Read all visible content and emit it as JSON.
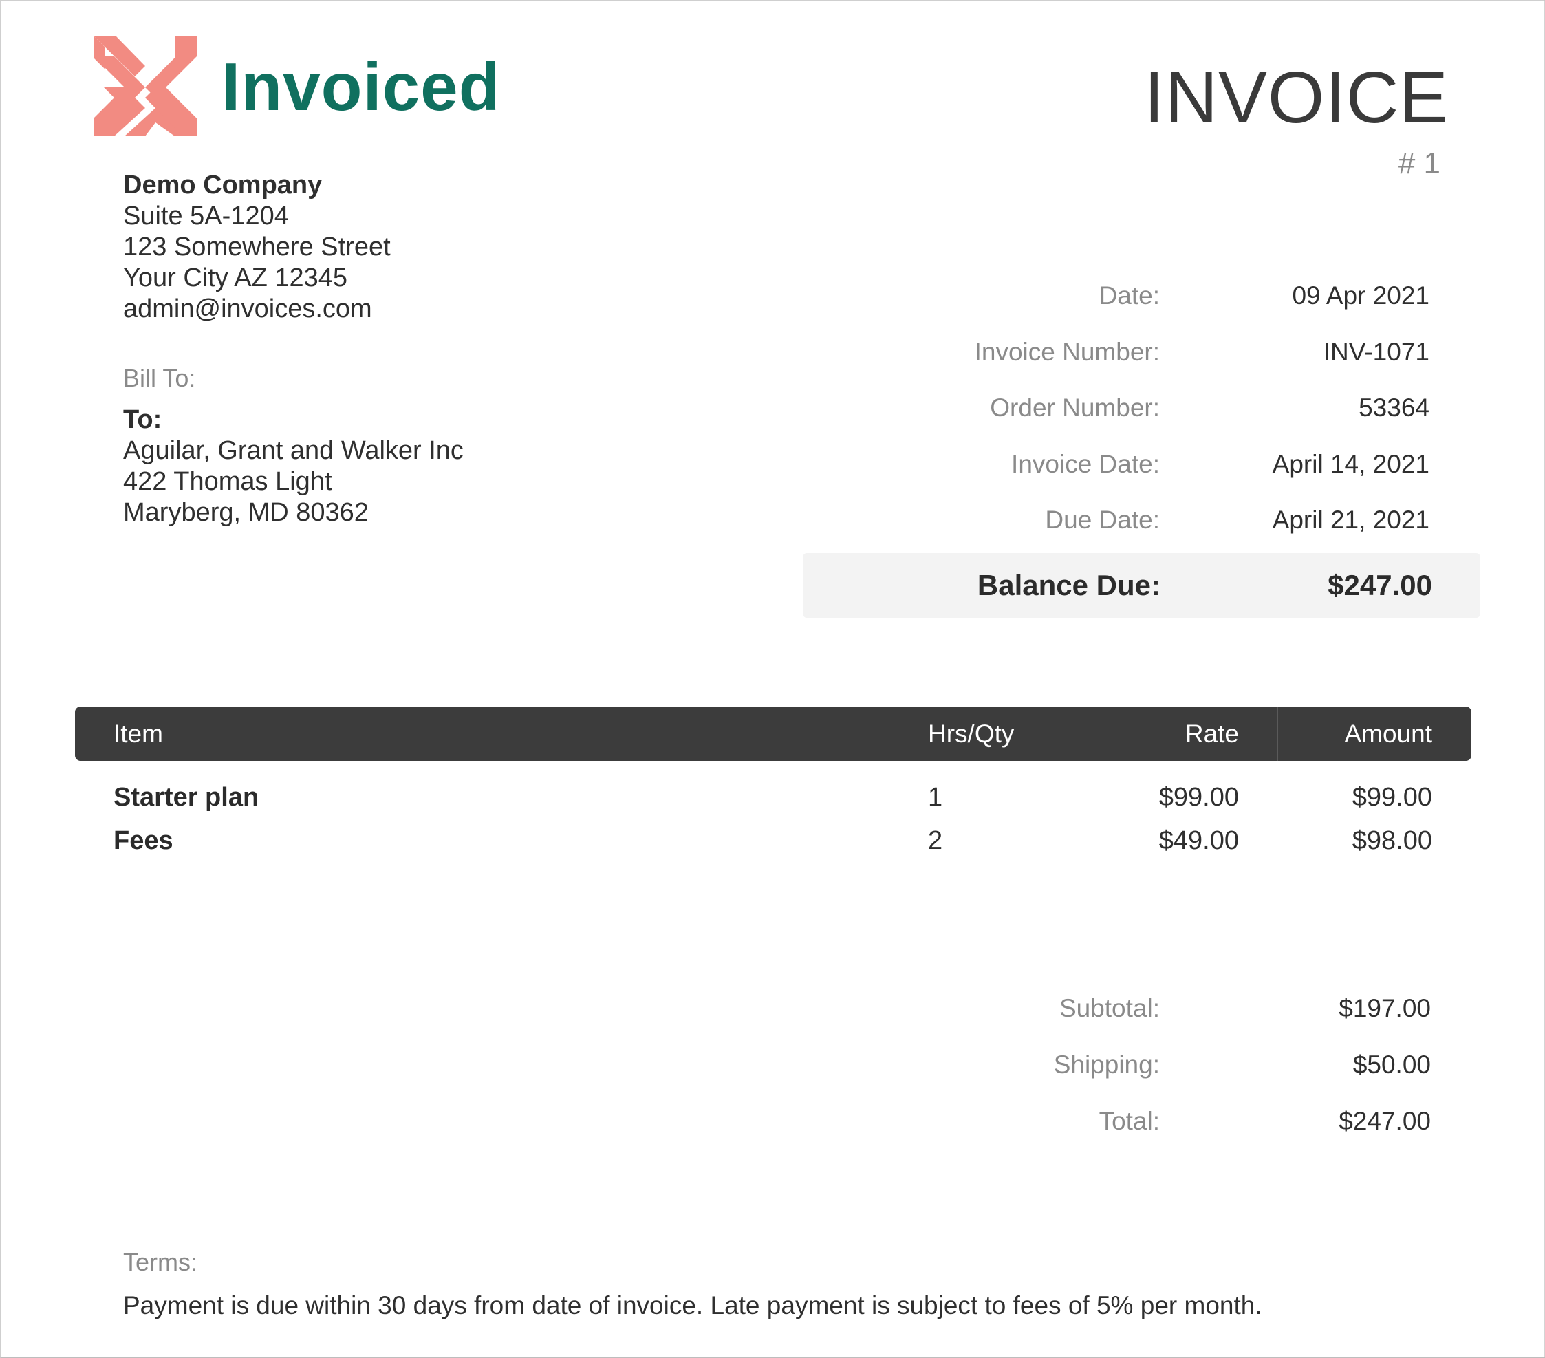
{
  "brand": {
    "name": "Invoiced",
    "logo_icon": "invoiced-chevron-x-logo",
    "logo_color": "#f28b82",
    "name_color": "#10705f"
  },
  "header": {
    "title": "INVOICE",
    "number": "# 1"
  },
  "from": {
    "company": "Demo Company",
    "address_lines": [
      "Suite 5A-1204",
      "123 Somewhere Street",
      "Your City AZ 12345"
    ],
    "email": "admin@invoices.com"
  },
  "bill_to": {
    "label": "Bill To:",
    "heading": "To:",
    "lines": [
      "Aguilar, Grant and Walker Inc",
      "422 Thomas Light",
      "Maryberg, MD 80362"
    ]
  },
  "meta": [
    {
      "label": "Date:",
      "value": "09 Apr 2021"
    },
    {
      "label": "Invoice Number:",
      "value": "INV-1071"
    },
    {
      "label": "Order Number:",
      "value": "53364"
    },
    {
      "label": "Invoice Date:",
      "value": "April 14, 2021"
    },
    {
      "label": "Due Date:",
      "value": "April 21, 2021"
    }
  ],
  "balance": {
    "label": "Balance Due:",
    "value": "$247.00"
  },
  "items_table": {
    "columns": [
      "Item",
      "Hrs/Qty",
      "Rate",
      "Amount"
    ],
    "header_bg": "#3c3c3c",
    "rows": [
      {
        "item": "Starter plan",
        "qty": "1",
        "rate": "$99.00",
        "amount": "$99.00"
      },
      {
        "item": "Fees",
        "qty": "2",
        "rate": "$49.00",
        "amount": "$98.00"
      }
    ]
  },
  "totals": [
    {
      "label": "Subtotal:",
      "value": "$197.00"
    },
    {
      "label": "Shipping:",
      "value": "$50.00"
    },
    {
      "label": "Total:",
      "value": "$247.00"
    }
  ],
  "terms": {
    "label": "Terms:",
    "text": "Payment is due within 30 days from date of invoice. Late payment is subject to fees of 5% per month."
  }
}
